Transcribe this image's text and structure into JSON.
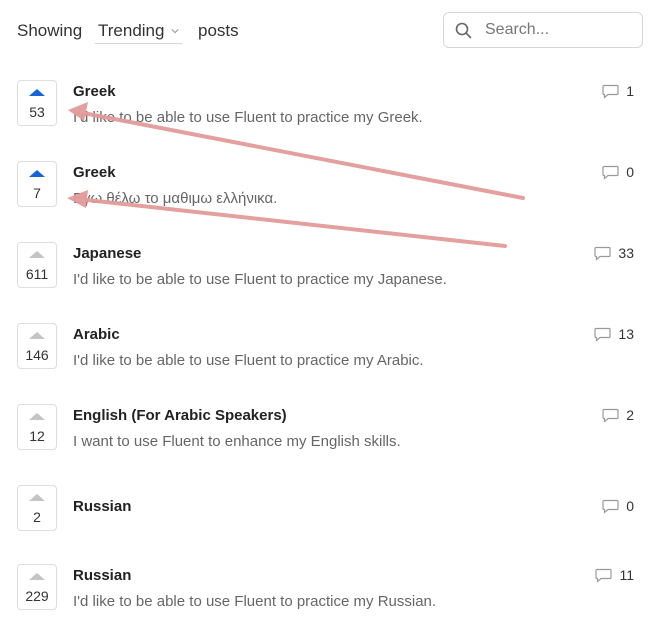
{
  "toolbar": {
    "showing_label": "Showing",
    "sort_value": "Trending",
    "posts_label": "posts",
    "search_placeholder": "Search..."
  },
  "posts": [
    {
      "title": "Greek",
      "description": "I'd like to be able to use Fluent to practice my Greek.",
      "votes": "53",
      "voted": true,
      "comments": "1"
    },
    {
      "title": "Greek",
      "description": "Εγω θέλω το μαθιμω ελλήνικα.",
      "votes": "7",
      "voted": true,
      "comments": "0"
    },
    {
      "title": "Japanese",
      "description": "I'd like to be able to use Fluent to practice my Japanese.",
      "votes": "611",
      "voted": false,
      "comments": "33"
    },
    {
      "title": "Arabic",
      "description": "I'd like to be able to use Fluent to practice my Arabic.",
      "votes": "146",
      "voted": false,
      "comments": "13"
    },
    {
      "title": "English (For Arabic Speakers)",
      "description": "I want to use Fluent to enhance my English skills.",
      "votes": "12",
      "voted": false,
      "comments": "2"
    },
    {
      "title": "Russian",
      "description": "",
      "votes": "2",
      "voted": false,
      "comments": "0"
    },
    {
      "title": "Russian",
      "description": "I'd like to be able to use Fluent to practice my Russian.",
      "votes": "229",
      "voted": false,
      "comments": "11"
    }
  ],
  "icons": {
    "search": "search-icon",
    "sort_chevron": "chevron-down-icon",
    "comment": "comment-icon",
    "upvote": "upvote-arrow-icon"
  },
  "colors": {
    "voted_arrow": "#1565d8",
    "unvoted_arrow": "#c4c4c4",
    "annotation_arrow": "#e39a9a"
  }
}
